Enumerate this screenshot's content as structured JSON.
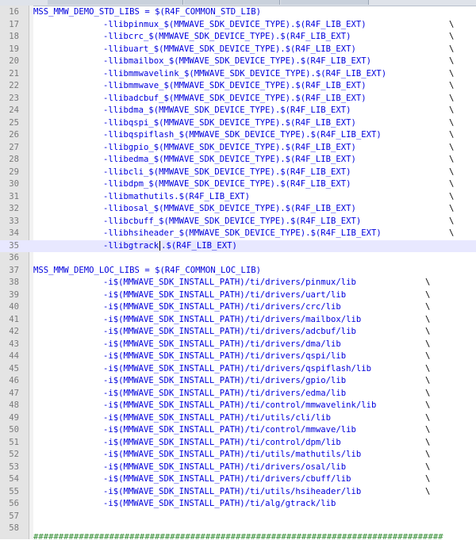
{
  "editor": {
    "std_header_line": "16",
    "std_var": "MSS_MMW_DEMO_STD_LIBS",
    "std_assign": " = $(R4F_COMMON_STD_LIB)",
    "std_libs": [
      {
        "ln": "17",
        "name": "-llibpinmux_$(MMWAVE_SDK_DEVICE_TYPE).$(R4F_LIB_EXT)",
        "cont": true
      },
      {
        "ln": "18",
        "name": "-llibcrc_$(MMWAVE_SDK_DEVICE_TYPE).$(R4F_LIB_EXT)",
        "cont": true
      },
      {
        "ln": "19",
        "name": "-llibuart_$(MMWAVE_SDK_DEVICE_TYPE).$(R4F_LIB_EXT)",
        "cont": true
      },
      {
        "ln": "20",
        "name": "-llibmailbox_$(MMWAVE_SDK_DEVICE_TYPE).$(R4F_LIB_EXT)",
        "cont": true
      },
      {
        "ln": "21",
        "name": "-llibmmwavelink_$(MMWAVE_SDK_DEVICE_TYPE).$(R4F_LIB_EXT)",
        "cont": true
      },
      {
        "ln": "22",
        "name": "-llibmmwave_$(MMWAVE_SDK_DEVICE_TYPE).$(R4F_LIB_EXT)",
        "cont": true
      },
      {
        "ln": "23",
        "name": "-llibadcbuf_$(MMWAVE_SDK_DEVICE_TYPE).$(R4F_LIB_EXT)",
        "cont": true
      },
      {
        "ln": "24",
        "name": "-llibdma_$(MMWAVE_SDK_DEVICE_TYPE).$(R4F_LIB_EXT)",
        "cont": true
      },
      {
        "ln": "25",
        "name": "-llibqspi_$(MMWAVE_SDK_DEVICE_TYPE).$(R4F_LIB_EXT)",
        "cont": true
      },
      {
        "ln": "26",
        "name": "-llibqspiflash_$(MMWAVE_SDK_DEVICE_TYPE).$(R4F_LIB_EXT)",
        "cont": true
      },
      {
        "ln": "27",
        "name": "-llibgpio_$(MMWAVE_SDK_DEVICE_TYPE).$(R4F_LIB_EXT)",
        "cont": true
      },
      {
        "ln": "28",
        "name": "-llibedma_$(MMWAVE_SDK_DEVICE_TYPE).$(R4F_LIB_EXT)",
        "cont": true
      },
      {
        "ln": "29",
        "name": "-llibcli_$(MMWAVE_SDK_DEVICE_TYPE).$(R4F_LIB_EXT)",
        "cont": true
      },
      {
        "ln": "30",
        "name": "-llibdpm_$(MMWAVE_SDK_DEVICE_TYPE).$(R4F_LIB_EXT)",
        "cont": true
      },
      {
        "ln": "31",
        "name": "-llibmathutils.$(R4F_LIB_EXT)",
        "cont": true
      },
      {
        "ln": "32",
        "name": "-llibosal_$(MMWAVE_SDK_DEVICE_TYPE).$(R4F_LIB_EXT)",
        "cont": true
      },
      {
        "ln": "33",
        "name": "-llibcbuff_$(MMWAVE_SDK_DEVICE_TYPE).$(R4F_LIB_EXT)",
        "cont": true
      },
      {
        "ln": "34",
        "name": "-llibhsiheader_$(MMWAVE_SDK_DEVICE_TYPE).$(R4F_LIB_EXT)",
        "cont": true
      },
      {
        "ln": "35",
        "name": "-llibgtrack",
        "after_caret": ".$(R4F_LIB_EXT)",
        "cont": false,
        "current": true
      }
    ],
    "blank_36": "36",
    "loc_header_line": "37",
    "loc_var": "MSS_MMW_DEMO_LOC_LIBS",
    "loc_assign": " = $(R4F_COMMON_LOC_LIB)",
    "loc_libs": [
      {
        "ln": "38",
        "name": "-i$(MMWAVE_SDK_INSTALL_PATH)/ti/drivers/pinmux/lib",
        "cont": true
      },
      {
        "ln": "39",
        "name": "-i$(MMWAVE_SDK_INSTALL_PATH)/ti/drivers/uart/lib",
        "cont": true
      },
      {
        "ln": "40",
        "name": "-i$(MMWAVE_SDK_INSTALL_PATH)/ti/drivers/crc/lib",
        "cont": true
      },
      {
        "ln": "41",
        "name": "-i$(MMWAVE_SDK_INSTALL_PATH)/ti/drivers/mailbox/lib",
        "cont": true
      },
      {
        "ln": "42",
        "name": "-i$(MMWAVE_SDK_INSTALL_PATH)/ti/drivers/adcbuf/lib",
        "cont": true
      },
      {
        "ln": "43",
        "name": "-i$(MMWAVE_SDK_INSTALL_PATH)/ti/drivers/dma/lib",
        "cont": true
      },
      {
        "ln": "44",
        "name": "-i$(MMWAVE_SDK_INSTALL_PATH)/ti/drivers/qspi/lib",
        "cont": true
      },
      {
        "ln": "45",
        "name": "-i$(MMWAVE_SDK_INSTALL_PATH)/ti/drivers/qspiflash/lib",
        "cont": true
      },
      {
        "ln": "46",
        "name": "-i$(MMWAVE_SDK_INSTALL_PATH)/ti/drivers/gpio/lib",
        "cont": true
      },
      {
        "ln": "47",
        "name": "-i$(MMWAVE_SDK_INSTALL_PATH)/ti/drivers/edma/lib",
        "cont": true
      },
      {
        "ln": "48",
        "name": "-i$(MMWAVE_SDK_INSTALL_PATH)/ti/control/mmwavelink/lib",
        "cont": true
      },
      {
        "ln": "49",
        "name": "-i$(MMWAVE_SDK_INSTALL_PATH)/ti/utils/cli/lib",
        "cont": true
      },
      {
        "ln": "50",
        "name": "-i$(MMWAVE_SDK_INSTALL_PATH)/ti/control/mmwave/lib",
        "cont": true
      },
      {
        "ln": "51",
        "name": "-i$(MMWAVE_SDK_INSTALL_PATH)/ti/control/dpm/lib",
        "cont": true
      },
      {
        "ln": "52",
        "name": "-i$(MMWAVE_SDK_INSTALL_PATH)/ti/utils/mathutils/lib",
        "cont": true
      },
      {
        "ln": "53",
        "name": "-i$(MMWAVE_SDK_INSTALL_PATH)/ti/drivers/osal/lib",
        "cont": true
      },
      {
        "ln": "54",
        "name": "-i$(MMWAVE_SDK_INSTALL_PATH)/ti/drivers/cbuff/lib",
        "cont": true
      },
      {
        "ln": "55",
        "name": "-i$(MMWAVE_SDK_INSTALL_PATH)/ti/utils/hsiheader/lib",
        "cont": true
      },
      {
        "ln": "56",
        "name": "-i$(MMWAVE_SDK_INSTALL_PATH)/ti/alg/gtrack/lib",
        "cont": false
      }
    ],
    "blank_57": "57",
    "blank_58": "58",
    "continuation": "\\",
    "hash_row": "#################################################################################"
  }
}
